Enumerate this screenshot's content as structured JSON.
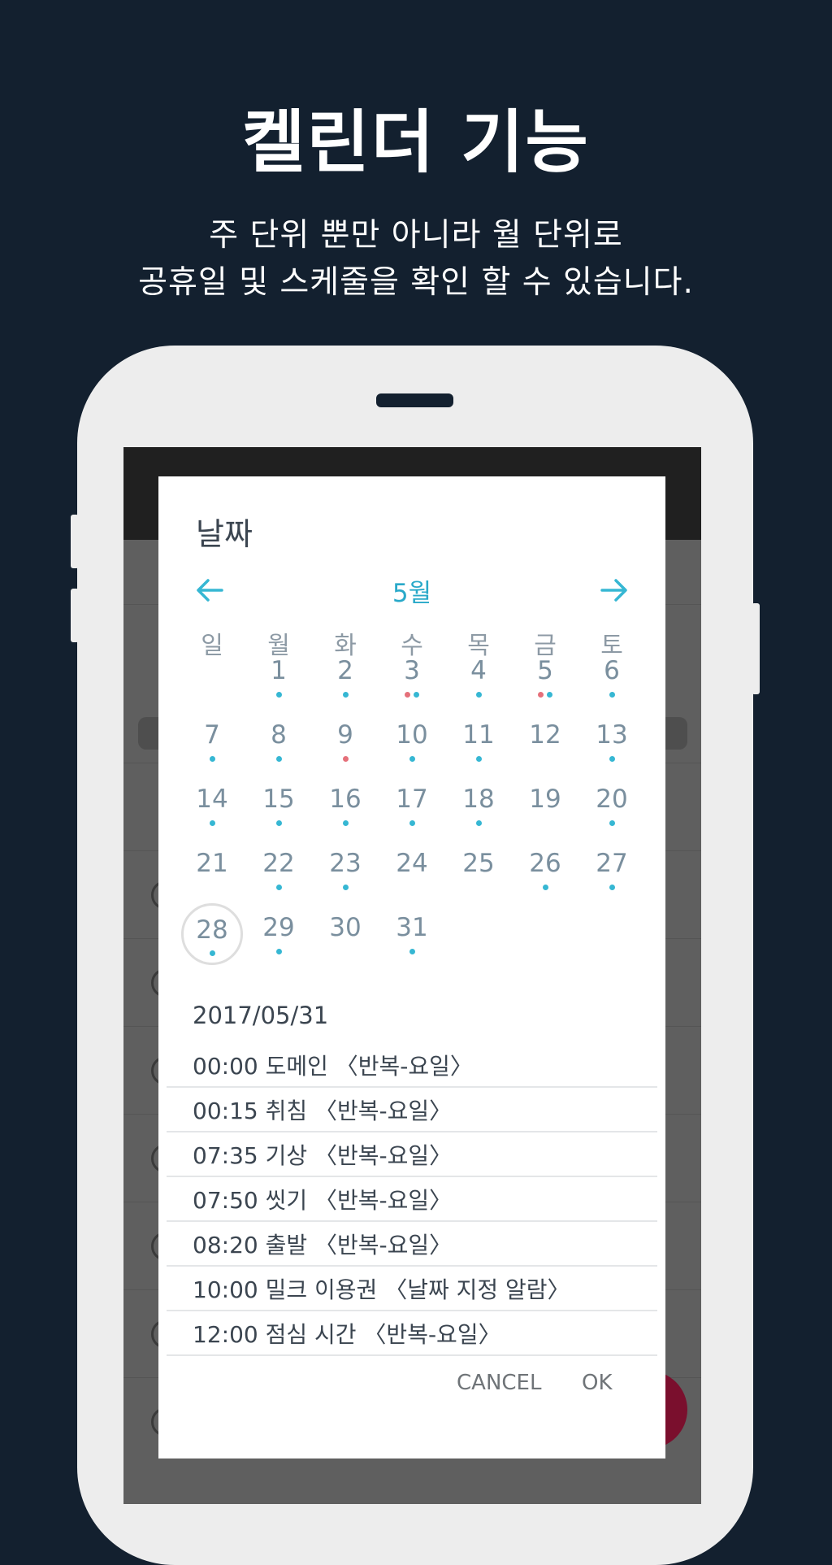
{
  "header": {
    "title": "켈린더 기능",
    "subtitle_line1": "주 단위 뿐만 아니라 월 단위로",
    "subtitle_line2": "공휴일 및 스케줄을 확인 할 수 있습니다."
  },
  "dialog": {
    "title": "날짜",
    "month": "5월",
    "weekdays": [
      "일",
      "월",
      "화",
      "수",
      "목",
      "금",
      "토"
    ],
    "days": [
      {
        "d": "1",
        "col": 1,
        "row": 0,
        "dots": [
          "blue"
        ]
      },
      {
        "d": "2",
        "col": 2,
        "row": 0,
        "dots": [
          "blue"
        ]
      },
      {
        "d": "3",
        "col": 3,
        "row": 0,
        "dots": [
          "red",
          "blue"
        ]
      },
      {
        "d": "4",
        "col": 4,
        "row": 0,
        "dots": [
          "blue"
        ]
      },
      {
        "d": "5",
        "col": 5,
        "row": 0,
        "dots": [
          "red",
          "blue"
        ]
      },
      {
        "d": "6",
        "col": 6,
        "row": 0,
        "dots": [
          "blue"
        ]
      },
      {
        "d": "7",
        "col": 0,
        "row": 1,
        "dots": [
          "blue"
        ]
      },
      {
        "d": "8",
        "col": 1,
        "row": 1,
        "dots": [
          "blue"
        ]
      },
      {
        "d": "9",
        "col": 2,
        "row": 1,
        "dots": [
          "red"
        ]
      },
      {
        "d": "10",
        "col": 3,
        "row": 1,
        "dots": [
          "blue"
        ]
      },
      {
        "d": "11",
        "col": 4,
        "row": 1,
        "dots": [
          "blue"
        ]
      },
      {
        "d": "12",
        "col": 5,
        "row": 1,
        "dots": []
      },
      {
        "d": "13",
        "col": 6,
        "row": 1,
        "dots": [
          "blue"
        ]
      },
      {
        "d": "14",
        "col": 0,
        "row": 2,
        "dots": [
          "blue"
        ]
      },
      {
        "d": "15",
        "col": 1,
        "row": 2,
        "dots": [
          "blue"
        ]
      },
      {
        "d": "16",
        "col": 2,
        "row": 2,
        "dots": [
          "blue"
        ]
      },
      {
        "d": "17",
        "col": 3,
        "row": 2,
        "dots": [
          "blue"
        ]
      },
      {
        "d": "18",
        "col": 4,
        "row": 2,
        "dots": [
          "blue"
        ]
      },
      {
        "d": "19",
        "col": 5,
        "row": 2,
        "dots": []
      },
      {
        "d": "20",
        "col": 6,
        "row": 2,
        "dots": [
          "blue"
        ]
      },
      {
        "d": "21",
        "col": 0,
        "row": 3,
        "dots": []
      },
      {
        "d": "22",
        "col": 1,
        "row": 3,
        "dots": [
          "blue"
        ]
      },
      {
        "d": "23",
        "col": 2,
        "row": 3,
        "dots": [
          "blue"
        ]
      },
      {
        "d": "24",
        "col": 3,
        "row": 3,
        "dots": []
      },
      {
        "d": "25",
        "col": 4,
        "row": 3,
        "dots": []
      },
      {
        "d": "26",
        "col": 5,
        "row": 3,
        "dots": [
          "blue"
        ]
      },
      {
        "d": "27",
        "col": 6,
        "row": 3,
        "dots": [
          "blue"
        ]
      },
      {
        "d": "28",
        "col": 0,
        "row": 4,
        "dots": [
          "blue"
        ],
        "selected": true
      },
      {
        "d": "29",
        "col": 1,
        "row": 4,
        "dots": [
          "blue"
        ]
      },
      {
        "d": "30",
        "col": 2,
        "row": 4,
        "dots": []
      },
      {
        "d": "31",
        "col": 3,
        "row": 4,
        "dots": [
          "blue"
        ]
      }
    ],
    "selected_date": "2017/05/31",
    "events": [
      "00:00  도메인 〈반복-요일〉",
      "00:15  취침 〈반복-요일〉",
      "07:35  기상 〈반복-요일〉",
      "07:50  씻기 〈반복-요일〉",
      "08:20  출발 〈반복-요일〉",
      "10:00  밀크 이용권 〈날짜 지정 알람〉",
      "12:00  점심 시간 〈반복-요일〉"
    ],
    "cancel_label": "CANCEL",
    "ok_label": "OK"
  },
  "colors": {
    "background": "#13202f",
    "accent": "#29a9c9",
    "dot_blue": "#36b7d3",
    "dot_red": "#e5707a"
  },
  "icons": {
    "prev": "arrow-left-icon",
    "next": "arrow-right-icon"
  }
}
